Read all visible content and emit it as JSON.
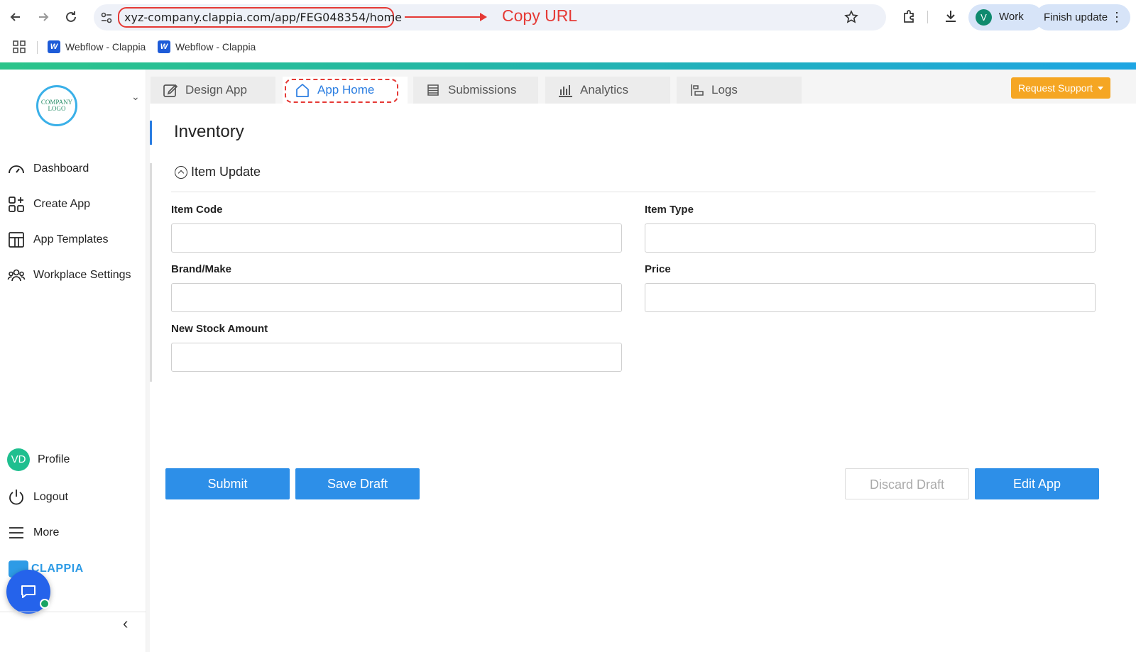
{
  "browser": {
    "url": "xyz-company.clappia.com/app/FEG048354/home",
    "annotation": "Copy URL",
    "profile_initial": "V",
    "profile_label": "Work",
    "update_label": "Finish update",
    "bookmarks": [
      "Webflow - Clappia",
      "Webflow - Clappia"
    ]
  },
  "sidebar": {
    "logo_text": "COMPANY LOGO",
    "items": [
      {
        "label": "Dashboard",
        "icon": "speedometer-icon"
      },
      {
        "label": "Create App",
        "icon": "grid-plus-icon"
      },
      {
        "label": "App Templates",
        "icon": "template-icon"
      },
      {
        "label": "Workplace Settings",
        "icon": "people-icon"
      }
    ],
    "profile": {
      "initials": "VD",
      "label": "Profile"
    },
    "logout_label": "Logout",
    "more_label": "More",
    "brand_text": "CLAPPIA"
  },
  "tabs": [
    {
      "label": "Design App",
      "icon": "edit-icon"
    },
    {
      "label": "App Home",
      "icon": "home-icon",
      "active": true
    },
    {
      "label": "Submissions",
      "icon": "list-icon"
    },
    {
      "label": "Analytics",
      "icon": "bar-chart-icon"
    },
    {
      "label": "Logs",
      "icon": "logs-icon"
    }
  ],
  "request_support_label": "Request Support",
  "form": {
    "title": "Inventory",
    "section": "Item Update",
    "fields": {
      "item_code": {
        "label": "Item Code",
        "value": ""
      },
      "item_type": {
        "label": "Item Type",
        "value": ""
      },
      "brand_make": {
        "label": "Brand/Make",
        "value": ""
      },
      "price": {
        "label": "Price",
        "value": ""
      },
      "new_stock_amount": {
        "label": "New Stock Amount",
        "value": ""
      }
    },
    "buttons": {
      "submit": "Submit",
      "save_draft": "Save Draft",
      "discard_draft": "Discard Draft",
      "edit_app": "Edit App"
    }
  },
  "colors": {
    "accent_blue": "#2d8fe8",
    "warning_orange": "#f5a623",
    "annotation_red": "#e53935"
  }
}
